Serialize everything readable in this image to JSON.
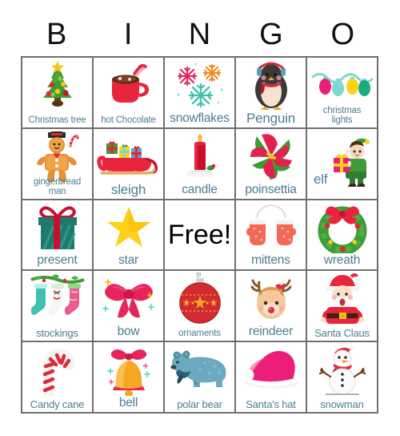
{
  "header": {
    "letters": [
      "B",
      "I",
      "N",
      "G",
      "O"
    ]
  },
  "colors": {
    "label_text": "#4a7e90",
    "grid_line": "#6f6f6f",
    "header_text": "#111111",
    "free_text": "#000000",
    "red": "#d92b3a",
    "crimson": "#c8102e",
    "pink": "#ec1e79",
    "magenta": "#e81c7f",
    "teal": "#1f7a6b",
    "green": "#3f9b35",
    "gold": "#f5c518",
    "orange": "#f08a1c",
    "mint": "#7fd8cd",
    "blue_gray": "#5b96a8",
    "brown": "#6b3f1d",
    "tan": "#e8a557"
  },
  "free_space": {
    "label": "Free!",
    "row": 3,
    "col": 3
  },
  "grid": {
    "rows": 5,
    "cols": 5,
    "cells": [
      {
        "label": "Christmas tree",
        "icon": "christmas-tree-icon",
        "size": "sm"
      },
      {
        "label": "hot Chocolate",
        "icon": "hot-chocolate-icon",
        "size": "sm"
      },
      {
        "label": "snowflakes",
        "icon": "snowflakes-icon",
        "size": "lg"
      },
      {
        "label": "Penguin",
        "icon": "penguin-icon",
        "size": "xl"
      },
      {
        "label": "christmas\nlights",
        "icon": "christmas-lights-icon",
        "size": "sm"
      },
      {
        "label": "gingerbread\nman",
        "icon": "gingerbread-man-icon",
        "size": "sm"
      },
      {
        "label": "sleigh",
        "icon": "sleigh-icon",
        "size": "xl"
      },
      {
        "label": "candle",
        "icon": "candle-icon",
        "size": "lg"
      },
      {
        "label": "poinsettia",
        "icon": "poinsettia-icon",
        "size": "lg"
      },
      {
        "label": "elf",
        "icon": "elf-icon",
        "size": "xl"
      },
      {
        "label": "present",
        "icon": "present-icon",
        "size": "lg"
      },
      {
        "label": "star",
        "icon": "star-icon",
        "size": "lg"
      },
      {
        "label": "Free!",
        "icon": "free-space",
        "size": "free"
      },
      {
        "label": "mittens",
        "icon": "mittens-icon",
        "size": "lg"
      },
      {
        "label": "wreath",
        "icon": "wreath-icon",
        "size": "lg"
      },
      {
        "label": "stockings",
        "icon": "stockings-icon",
        "size": "md"
      },
      {
        "label": "bow",
        "icon": "bow-icon",
        "size": "lg"
      },
      {
        "label": "ornaments",
        "icon": "ornaments-icon",
        "size": "sm"
      },
      {
        "label": "reindeer",
        "icon": "reindeer-icon",
        "size": "lg"
      },
      {
        "label": "Santa Claus",
        "icon": "santa-claus-icon",
        "size": "md"
      },
      {
        "label": "Candy cane",
        "icon": "candy-cane-icon",
        "size": "md"
      },
      {
        "label": "bell",
        "icon": "bell-icon",
        "size": "lg"
      },
      {
        "label": "polar bear",
        "icon": "polar-bear-icon",
        "size": "md"
      },
      {
        "label": "Santa's hat",
        "icon": "santas-hat-icon",
        "size": "md"
      },
      {
        "label": "snowman",
        "icon": "snowman-icon",
        "size": "md"
      }
    ]
  }
}
